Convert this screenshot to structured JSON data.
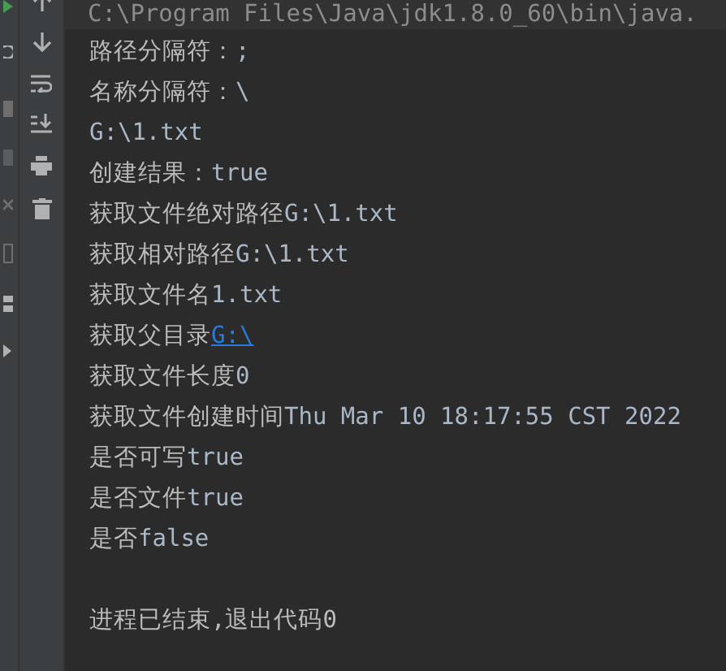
{
  "command_line": "C:\\Program Files\\Java\\jdk1.8.0_60\\bin\\java.",
  "lines": [
    {
      "label": "路径分隔符：",
      "value": ";",
      "kind": "text"
    },
    {
      "label": "名称分隔符：",
      "value": "\\",
      "kind": "text"
    },
    {
      "value": "G:\\1.txt",
      "kind": "text"
    },
    {
      "label": "创建结果：",
      "value": "true",
      "kind": "text"
    },
    {
      "label": "获取文件绝对路径",
      "value": "G:\\1.txt",
      "kind": "text"
    },
    {
      "label": "获取相对路径",
      "value": "G:\\1.txt",
      "kind": "text"
    },
    {
      "label": "获取文件名",
      "value": "1.txt",
      "kind": "text"
    },
    {
      "label": "获取父目录",
      "value": "G:\\",
      "kind": "link"
    },
    {
      "label": "获取文件长度",
      "value": "0",
      "kind": "text"
    },
    {
      "label": "获取文件创建时间",
      "value": "Thu Mar 10 18:17:55 CST 2022",
      "kind": "text"
    },
    {
      "label": "是否可写",
      "value": "true",
      "kind": "text"
    },
    {
      "label": "是否文件",
      "value": "true",
      "kind": "text"
    },
    {
      "label": "是否",
      "value": "false",
      "kind": "text"
    }
  ],
  "exit_message": "进程已结束,退出代码0"
}
